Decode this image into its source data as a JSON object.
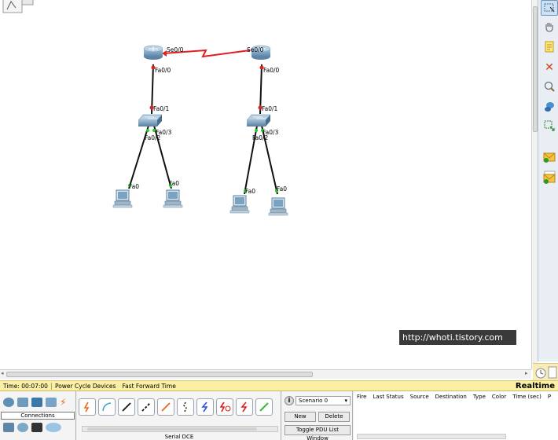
{
  "workspace": {
    "interfaces": {
      "router_left_serial": "Se0/0",
      "router_right_serial": "Se0/0",
      "router_left_fa": "Fa0/0",
      "router_right_fa": "Fa0/0",
      "switch_left_uplink": "Fa0/1",
      "switch_right_uplink": "Fa0/1",
      "switch_left_p3": "Fa0/3",
      "switch_left_p2": "Fa0/2",
      "switch_right_p3": "Fa0/3",
      "switch_right_p2": "Fa0/2",
      "pc1_fa": "Fa0",
      "pc2_fa": "Fa0",
      "pc3_fa": "Fa0",
      "pc4_fa": "Fa0"
    },
    "colors": {
      "serial_link": "#e02020",
      "ethernet_link": "#111111",
      "link_up": "#22cc22",
      "link_down": "#dd2222",
      "device": "#6e96b8"
    }
  },
  "watermark": "http://whoti.tistory.com",
  "statusbar": {
    "time": "Time: 00:07:00",
    "power_cycle": "Power Cycle Devices",
    "fast_forward": "Fast Forward Time",
    "mode": "Realtime"
  },
  "bottom": {
    "connections_label": "Connections",
    "cable_label": "Serial DCE",
    "scenario_select": "Scenario 0",
    "new_button": "New",
    "delete_button": "Delete",
    "toggle_button": "Toggle PDU List Window",
    "pdu_columns": [
      "Fire",
      "Last Status",
      "Source",
      "Destination",
      "Type",
      "Color",
      "Time (sec)",
      "P"
    ]
  }
}
